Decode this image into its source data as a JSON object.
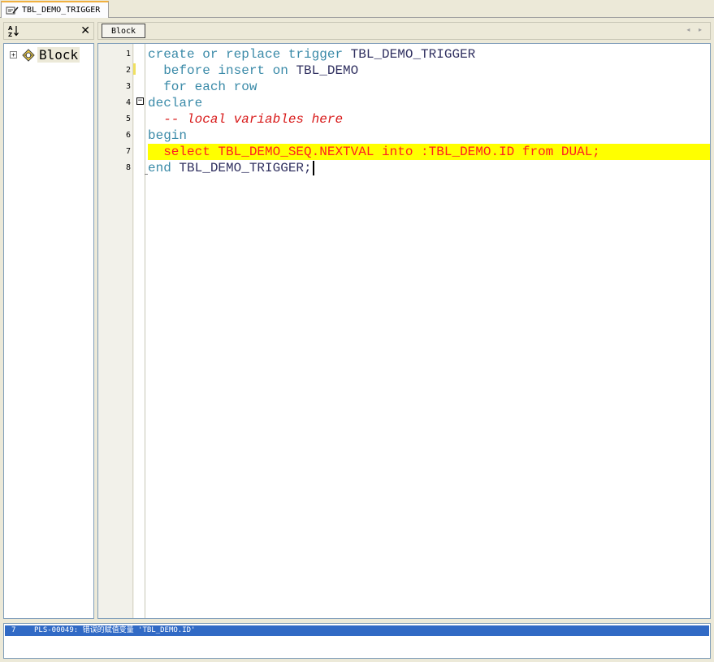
{
  "tab": {
    "title": "TBL_DEMO_TRIGGER"
  },
  "tree": {
    "node_label": "Block",
    "expander": "+"
  },
  "toolbar": {
    "block_label": "Block",
    "scroll_arrows": "◂ ▸"
  },
  "editor": {
    "line_numbers": [
      "1",
      "2",
      "3",
      "4",
      "5",
      "6",
      "7",
      "8"
    ],
    "fold_symbol": "−",
    "lines": [
      [
        {
          "t": "create or replace trigger ",
          "c": "kw"
        },
        {
          "t": "TBL_DEMO_TRIGGER",
          "c": "id"
        }
      ],
      [
        {
          "t": "  before insert on ",
          "c": "kw"
        },
        {
          "t": "TBL_DEMO",
          "c": "id"
        }
      ],
      [
        {
          "t": "  for each row",
          "c": "kw"
        }
      ],
      [
        {
          "t": "declare",
          "c": "kw"
        }
      ],
      [
        {
          "t": "  -- local variables here",
          "c": "cm"
        }
      ],
      [
        {
          "t": "begin",
          "c": "kw"
        }
      ],
      [
        {
          "t": "  select TBL_DEMO_SEQ.NEXTVAL into :TBL_DEMO.ID from DUAL;",
          "c": "err"
        }
      ],
      [
        {
          "t": "end ",
          "c": "kw"
        },
        {
          "t": "TBL_DEMO_TRIGGER;",
          "c": "id"
        }
      ]
    ],
    "highlighted_line": 7,
    "caret_line": 8
  },
  "messages": [
    {
      "line": "7",
      "text": "PLS-00049: 错误的赋值变量 'TBL_DEMO.ID'"
    }
  ],
  "colors": {
    "highlight": "#ffff00",
    "selection": "#316ac5",
    "keyword": "#3a8aa8",
    "comment": "#d81818"
  }
}
